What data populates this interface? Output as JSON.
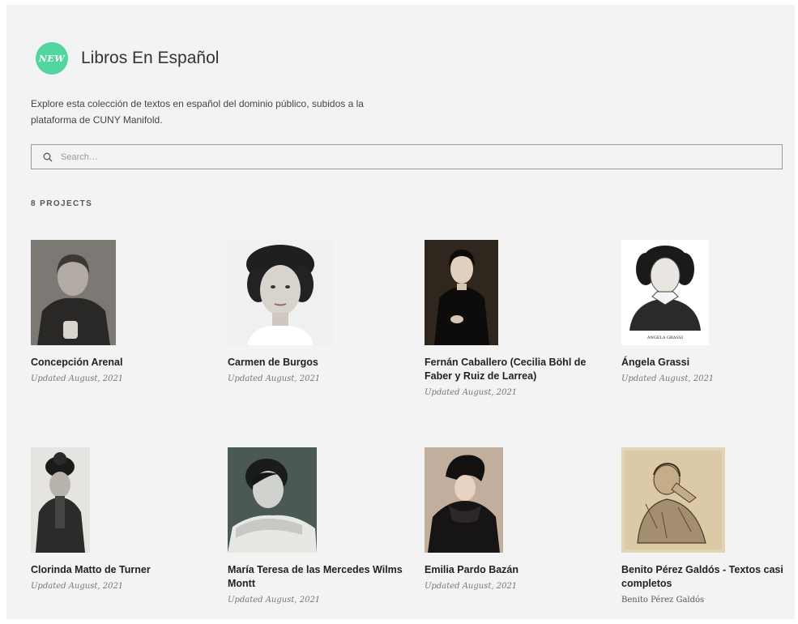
{
  "header": {
    "badge": "NEW",
    "title": "Libros En Español"
  },
  "description": "Explore esta colección de textos en español del dominio público, subidos a la plataforma de CUNY Manifold.",
  "search": {
    "placeholder": "Search…"
  },
  "project_count": "8 PROJECTS",
  "projects": [
    {
      "title": "Concepción Arenal",
      "meta": "Updated August, 2021"
    },
    {
      "title": "Carmen de Burgos",
      "meta": "Updated August, 2021"
    },
    {
      "title": "Fernán Caballero (Cecilia Böhl de Faber y Ruiz de Larrea)",
      "meta": "Updated August, 2021"
    },
    {
      "title": "Ángela Grassi",
      "meta": "Updated August, 2021",
      "caption": "ÁNGELA GRASSI"
    },
    {
      "title": "Clorinda Matto de Turner",
      "meta": "Updated August, 2021"
    },
    {
      "title": "María Teresa de las Mercedes Wilms Montt",
      "meta": "Updated August, 2021"
    },
    {
      "title": "Emilia Pardo Bazán",
      "meta": "Updated August, 2021"
    },
    {
      "title": "Benito Pérez Galdós - Textos casi completos",
      "meta": "Benito Pérez Galdós"
    }
  ],
  "icons": {
    "search": "search-icon"
  },
  "colors": {
    "badge": "#52d69f",
    "panel": "#f3f3f3"
  }
}
